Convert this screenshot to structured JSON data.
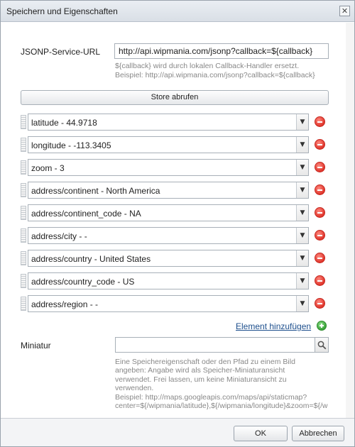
{
  "dialog": {
    "title": "Speichern und Eigenschaften",
    "close_glyph": "✕"
  },
  "jsonp": {
    "label": "JSONP-Service-URL",
    "value": "http://api.wipmania.com/jsonp?callback=${callback}",
    "help_line1": "${callback} wird durch lokalen Callback-Handler ersetzt.",
    "help_line2": "Beispiel: http://api.wipmania.com/jsonp?callback=${callback}"
  },
  "store_button": {
    "label": "Store abrufen"
  },
  "properties": [
    {
      "label": "latitude - 44.9718"
    },
    {
      "label": "longitude - -113.3405"
    },
    {
      "label": "zoom - 3"
    },
    {
      "label": "address/continent - North America"
    },
    {
      "label": "address/continent_code - NA"
    },
    {
      "label": "address/city - -"
    },
    {
      "label": "address/country - United States"
    },
    {
      "label": "address/country_code - US"
    },
    {
      "label": "address/region - -"
    }
  ],
  "add_element": {
    "label": "Element hinzufügen"
  },
  "miniatur": {
    "label": "Miniatur",
    "value": "",
    "help_lines": [
      "Eine Speichereigenschaft oder den Pfad zu einem Bild",
      "angeben: Angabe wird als Speicher-Miniaturansicht",
      "verwendet. Frei lassen, um keine Miniaturansicht zu",
      "verwenden.",
      "Beispiel: http://maps.googleapis.com/maps/api/staticmap?",
      "center=${/wipmania/latitude},${/wipmania/longitude}&zoom=${/w"
    ]
  },
  "footer": {
    "ok_label": "OK",
    "cancel_label": "Abbrechen"
  },
  "icons": {
    "close": "close-icon",
    "remove": "remove-icon",
    "add": "add-icon",
    "search": "search-icon",
    "dropdown": "chevron-down-icon",
    "drag": "drag-handle-icon"
  },
  "colors": {
    "link": "#1c4e8c",
    "remove": "#e0352b",
    "add": "#3aa33a"
  }
}
